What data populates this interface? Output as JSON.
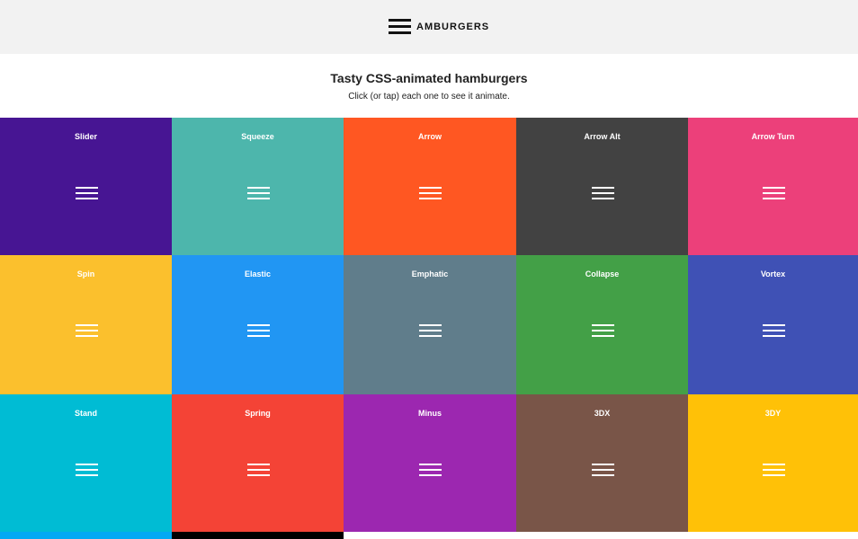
{
  "header": {
    "logo_text": "AMBURGERS",
    "logo_icon": "hamburger-icon"
  },
  "intro": {
    "title": "Tasty CSS-animated hamburgers",
    "subtitle": "Click (or tap) each one to see it animate."
  },
  "tiles": [
    {
      "label": "Slider",
      "color": "#471593"
    },
    {
      "label": "Squeeze",
      "color": "#4db6ac"
    },
    {
      "label": "Arrow",
      "color": "#ff5722"
    },
    {
      "label": "Arrow Alt",
      "color": "#424242"
    },
    {
      "label": "Arrow Turn",
      "color": "#ec407a"
    },
    {
      "label": "Spin",
      "color": "#fbc02d"
    },
    {
      "label": "Elastic",
      "color": "#2196f3"
    },
    {
      "label": "Emphatic",
      "color": "#607d8b"
    },
    {
      "label": "Collapse",
      "color": "#43a047"
    },
    {
      "label": "Vortex",
      "color": "#3f51b5"
    },
    {
      "label": "Stand",
      "color": "#00bcd4"
    },
    {
      "label": "Spring",
      "color": "#f44336"
    },
    {
      "label": "Minus",
      "color": "#9c27b0"
    },
    {
      "label": "3DX",
      "color": "#795548"
    },
    {
      "label": "3DY",
      "color": "#ffc107"
    }
  ],
  "partial_row_colors": [
    "#03a9f4",
    "#000000"
  ]
}
